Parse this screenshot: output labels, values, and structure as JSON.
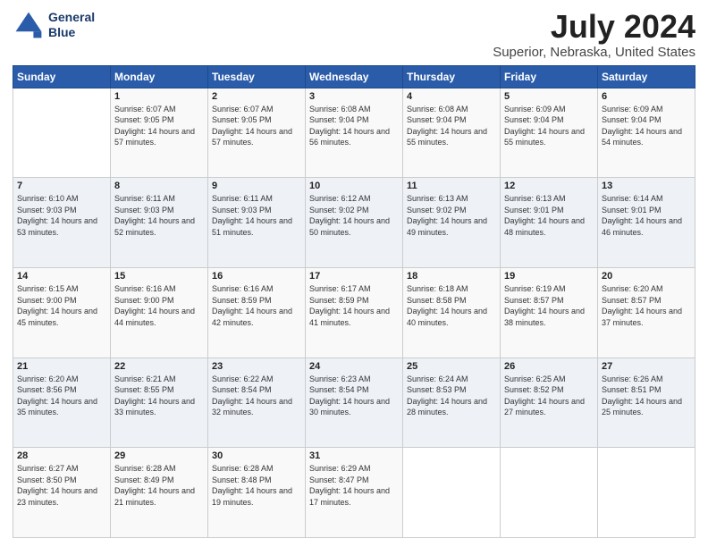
{
  "header": {
    "logo_line1": "General",
    "logo_line2": "Blue",
    "month": "July 2024",
    "location": "Superior, Nebraska, United States"
  },
  "weekdays": [
    "Sunday",
    "Monday",
    "Tuesday",
    "Wednesday",
    "Thursday",
    "Friday",
    "Saturday"
  ],
  "weeks": [
    [
      {
        "day": "",
        "sunrise": "",
        "sunset": "",
        "daylight": ""
      },
      {
        "day": "1",
        "sunrise": "Sunrise: 6:07 AM",
        "sunset": "Sunset: 9:05 PM",
        "daylight": "Daylight: 14 hours and 57 minutes."
      },
      {
        "day": "2",
        "sunrise": "Sunrise: 6:07 AM",
        "sunset": "Sunset: 9:05 PM",
        "daylight": "Daylight: 14 hours and 57 minutes."
      },
      {
        "day": "3",
        "sunrise": "Sunrise: 6:08 AM",
        "sunset": "Sunset: 9:04 PM",
        "daylight": "Daylight: 14 hours and 56 minutes."
      },
      {
        "day": "4",
        "sunrise": "Sunrise: 6:08 AM",
        "sunset": "Sunset: 9:04 PM",
        "daylight": "Daylight: 14 hours and 55 minutes."
      },
      {
        "day": "5",
        "sunrise": "Sunrise: 6:09 AM",
        "sunset": "Sunset: 9:04 PM",
        "daylight": "Daylight: 14 hours and 55 minutes."
      },
      {
        "day": "6",
        "sunrise": "Sunrise: 6:09 AM",
        "sunset": "Sunset: 9:04 PM",
        "daylight": "Daylight: 14 hours and 54 minutes."
      }
    ],
    [
      {
        "day": "7",
        "sunrise": "Sunrise: 6:10 AM",
        "sunset": "Sunset: 9:03 PM",
        "daylight": "Daylight: 14 hours and 53 minutes."
      },
      {
        "day": "8",
        "sunrise": "Sunrise: 6:11 AM",
        "sunset": "Sunset: 9:03 PM",
        "daylight": "Daylight: 14 hours and 52 minutes."
      },
      {
        "day": "9",
        "sunrise": "Sunrise: 6:11 AM",
        "sunset": "Sunset: 9:03 PM",
        "daylight": "Daylight: 14 hours and 51 minutes."
      },
      {
        "day": "10",
        "sunrise": "Sunrise: 6:12 AM",
        "sunset": "Sunset: 9:02 PM",
        "daylight": "Daylight: 14 hours and 50 minutes."
      },
      {
        "day": "11",
        "sunrise": "Sunrise: 6:13 AM",
        "sunset": "Sunset: 9:02 PM",
        "daylight": "Daylight: 14 hours and 49 minutes."
      },
      {
        "day": "12",
        "sunrise": "Sunrise: 6:13 AM",
        "sunset": "Sunset: 9:01 PM",
        "daylight": "Daylight: 14 hours and 48 minutes."
      },
      {
        "day": "13",
        "sunrise": "Sunrise: 6:14 AM",
        "sunset": "Sunset: 9:01 PM",
        "daylight": "Daylight: 14 hours and 46 minutes."
      }
    ],
    [
      {
        "day": "14",
        "sunrise": "Sunrise: 6:15 AM",
        "sunset": "Sunset: 9:00 PM",
        "daylight": "Daylight: 14 hours and 45 minutes."
      },
      {
        "day": "15",
        "sunrise": "Sunrise: 6:16 AM",
        "sunset": "Sunset: 9:00 PM",
        "daylight": "Daylight: 14 hours and 44 minutes."
      },
      {
        "day": "16",
        "sunrise": "Sunrise: 6:16 AM",
        "sunset": "Sunset: 8:59 PM",
        "daylight": "Daylight: 14 hours and 42 minutes."
      },
      {
        "day": "17",
        "sunrise": "Sunrise: 6:17 AM",
        "sunset": "Sunset: 8:59 PM",
        "daylight": "Daylight: 14 hours and 41 minutes."
      },
      {
        "day": "18",
        "sunrise": "Sunrise: 6:18 AM",
        "sunset": "Sunset: 8:58 PM",
        "daylight": "Daylight: 14 hours and 40 minutes."
      },
      {
        "day": "19",
        "sunrise": "Sunrise: 6:19 AM",
        "sunset": "Sunset: 8:57 PM",
        "daylight": "Daylight: 14 hours and 38 minutes."
      },
      {
        "day": "20",
        "sunrise": "Sunrise: 6:20 AM",
        "sunset": "Sunset: 8:57 PM",
        "daylight": "Daylight: 14 hours and 37 minutes."
      }
    ],
    [
      {
        "day": "21",
        "sunrise": "Sunrise: 6:20 AM",
        "sunset": "Sunset: 8:56 PM",
        "daylight": "Daylight: 14 hours and 35 minutes."
      },
      {
        "day": "22",
        "sunrise": "Sunrise: 6:21 AM",
        "sunset": "Sunset: 8:55 PM",
        "daylight": "Daylight: 14 hours and 33 minutes."
      },
      {
        "day": "23",
        "sunrise": "Sunrise: 6:22 AM",
        "sunset": "Sunset: 8:54 PM",
        "daylight": "Daylight: 14 hours and 32 minutes."
      },
      {
        "day": "24",
        "sunrise": "Sunrise: 6:23 AM",
        "sunset": "Sunset: 8:54 PM",
        "daylight": "Daylight: 14 hours and 30 minutes."
      },
      {
        "day": "25",
        "sunrise": "Sunrise: 6:24 AM",
        "sunset": "Sunset: 8:53 PM",
        "daylight": "Daylight: 14 hours and 28 minutes."
      },
      {
        "day": "26",
        "sunrise": "Sunrise: 6:25 AM",
        "sunset": "Sunset: 8:52 PM",
        "daylight": "Daylight: 14 hours and 27 minutes."
      },
      {
        "day": "27",
        "sunrise": "Sunrise: 6:26 AM",
        "sunset": "Sunset: 8:51 PM",
        "daylight": "Daylight: 14 hours and 25 minutes."
      }
    ],
    [
      {
        "day": "28",
        "sunrise": "Sunrise: 6:27 AM",
        "sunset": "Sunset: 8:50 PM",
        "daylight": "Daylight: 14 hours and 23 minutes."
      },
      {
        "day": "29",
        "sunrise": "Sunrise: 6:28 AM",
        "sunset": "Sunset: 8:49 PM",
        "daylight": "Daylight: 14 hours and 21 minutes."
      },
      {
        "day": "30",
        "sunrise": "Sunrise: 6:28 AM",
        "sunset": "Sunset: 8:48 PM",
        "daylight": "Daylight: 14 hours and 19 minutes."
      },
      {
        "day": "31",
        "sunrise": "Sunrise: 6:29 AM",
        "sunset": "Sunset: 8:47 PM",
        "daylight": "Daylight: 14 hours and 17 minutes."
      },
      {
        "day": "",
        "sunrise": "",
        "sunset": "",
        "daylight": ""
      },
      {
        "day": "",
        "sunrise": "",
        "sunset": "",
        "daylight": ""
      },
      {
        "day": "",
        "sunrise": "",
        "sunset": "",
        "daylight": ""
      }
    ]
  ]
}
